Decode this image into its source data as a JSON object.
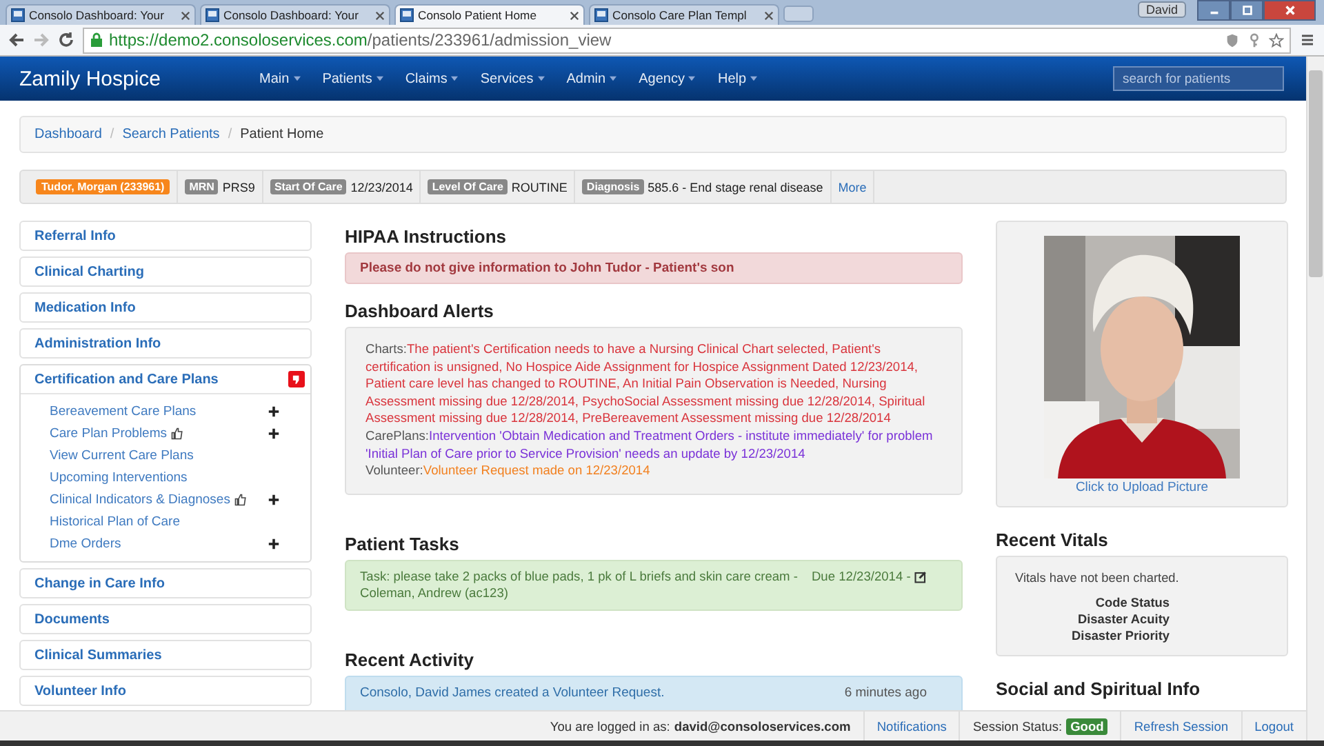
{
  "browser": {
    "tabs": [
      {
        "title": "Consolo Dashboard: Your",
        "selected": false
      },
      {
        "title": "Consolo Dashboard: Your",
        "selected": false
      },
      {
        "title": "Consolo Patient Home",
        "selected": true
      },
      {
        "title": "Consolo Care Plan Templ",
        "selected": false
      }
    ],
    "user": "David",
    "url_host": "https://demo2.consoloservices.com",
    "url_path": "/patients/233961/admission_view"
  },
  "navbar": {
    "brand": "Zamily Hospice",
    "menus": [
      "Main",
      "Patients",
      "Claims",
      "Services",
      "Admin",
      "Agency",
      "Help"
    ],
    "search": {
      "placeholder": "search for patients"
    }
  },
  "breadcrumb_separator": "/",
  "breadcrumb": [
    {
      "label": "Dashboard",
      "link": true
    },
    {
      "label": "Search Patients",
      "link": true
    },
    {
      "label": "Patient Home",
      "link": false
    }
  ],
  "patient_bar": {
    "name": "Tudor, Morgan (233961)",
    "fields": [
      {
        "label": "MRN",
        "value": "PRS9"
      },
      {
        "label": "Start Of Care",
        "value": "12/23/2014"
      },
      {
        "label": "Level Of Care",
        "value": "ROUTINE"
      },
      {
        "label": "Diagnosis",
        "value": "585.6 - End stage renal disease"
      }
    ],
    "more": "More"
  },
  "sidebar": [
    {
      "label": "Referral Info",
      "expanded": false,
      "flagged": false
    },
    {
      "label": "Clinical Charting",
      "expanded": false,
      "flagged": false
    },
    {
      "label": "Medication Info",
      "expanded": false,
      "flagged": false
    },
    {
      "label": "Administration Info",
      "expanded": false,
      "flagged": false
    },
    {
      "label": "Certification and Care Plans",
      "expanded": true,
      "flagged": true,
      "children": [
        {
          "label": "Bereavement Care Plans",
          "thumb": false,
          "add": true
        },
        {
          "label": "Care Plan Problems",
          "thumb": true,
          "add": true
        },
        {
          "label": "View Current Care Plans",
          "thumb": false,
          "add": false
        },
        {
          "label": "Upcoming Interventions",
          "thumb": false,
          "add": false
        },
        {
          "label": "Clinical Indicators & Diagnoses",
          "thumb": true,
          "add": true
        },
        {
          "label": "Historical Plan of Care",
          "thumb": false,
          "add": false
        },
        {
          "label": "Dme Orders",
          "thumb": false,
          "add": true
        }
      ]
    },
    {
      "label": "Change in Care Info",
      "expanded": false,
      "flagged": false
    },
    {
      "label": "Documents",
      "expanded": false,
      "flagged": false
    },
    {
      "label": "Clinical Summaries",
      "expanded": false,
      "flagged": false
    },
    {
      "label": "Volunteer Info",
      "expanded": false,
      "flagged": false
    }
  ],
  "hipaa": {
    "title": "HIPAA Instructions",
    "text": "Please do not give information to John Tudor - Patient's son"
  },
  "alerts": {
    "title": "Dashboard Alerts",
    "items": [
      {
        "label": "Charts:",
        "text": "The patient's Certification needs to have a Nursing Clinical Chart selected, Patient's certification is unsigned, No Hospice Aide Assignment for Hospice Assignment Dated 12/23/2014, Patient care level has changed to ROUTINE, An Initial Pain Observation is Needed, Nursing Assessment missing due 12/28/2014, PsychoSocial Assessment missing due 12/28/2014, Spiritual Assessment missing due 12/28/2014, PreBereavement Assessment missing due 12/28/2014",
        "color": "#d9343c"
      },
      {
        "label": "CarePlans:",
        "text": "Intervention 'Obtain Medication and Treatment Orders - institute immediately' for problem 'Initial Plan of Care prior to Service Provision' needs an update by 12/23/2014",
        "color": "#7a32d8"
      },
      {
        "label": "Volunteer:",
        "text": "Volunteer Request made on 12/23/2014",
        "color": "#f2801f"
      }
    ]
  },
  "tasks": {
    "title": "Patient Tasks",
    "text": "Task: please take 2 packs of blue pads, 1 pk of L briefs and skin care cream -",
    "due": "Due 12/23/2014 -",
    "assignee": "Coleman, Andrew (ac123)"
  },
  "activity": {
    "title": "Recent Activity",
    "items": [
      {
        "text": "Consolo, David James created a Volunteer Request.",
        "time": "6 minutes ago"
      }
    ]
  },
  "photo": {
    "kind": "picture",
    "upload": "Click to Upload Picture"
  },
  "vitals": {
    "title": "Recent Vitals",
    "empty": "Vitals have not been charted.",
    "labels": [
      "Code Status",
      "Disaster Acuity",
      "Disaster Priority"
    ]
  },
  "social": {
    "title": "Social and Spiritual Info"
  },
  "footer": {
    "login": "You are logged in as: **david@consoloservices.com**",
    "notifications": "Notifications",
    "session_label": "Session Status:",
    "session": "Good",
    "refresh": "Refresh Session",
    "logout": "Logout"
  }
}
